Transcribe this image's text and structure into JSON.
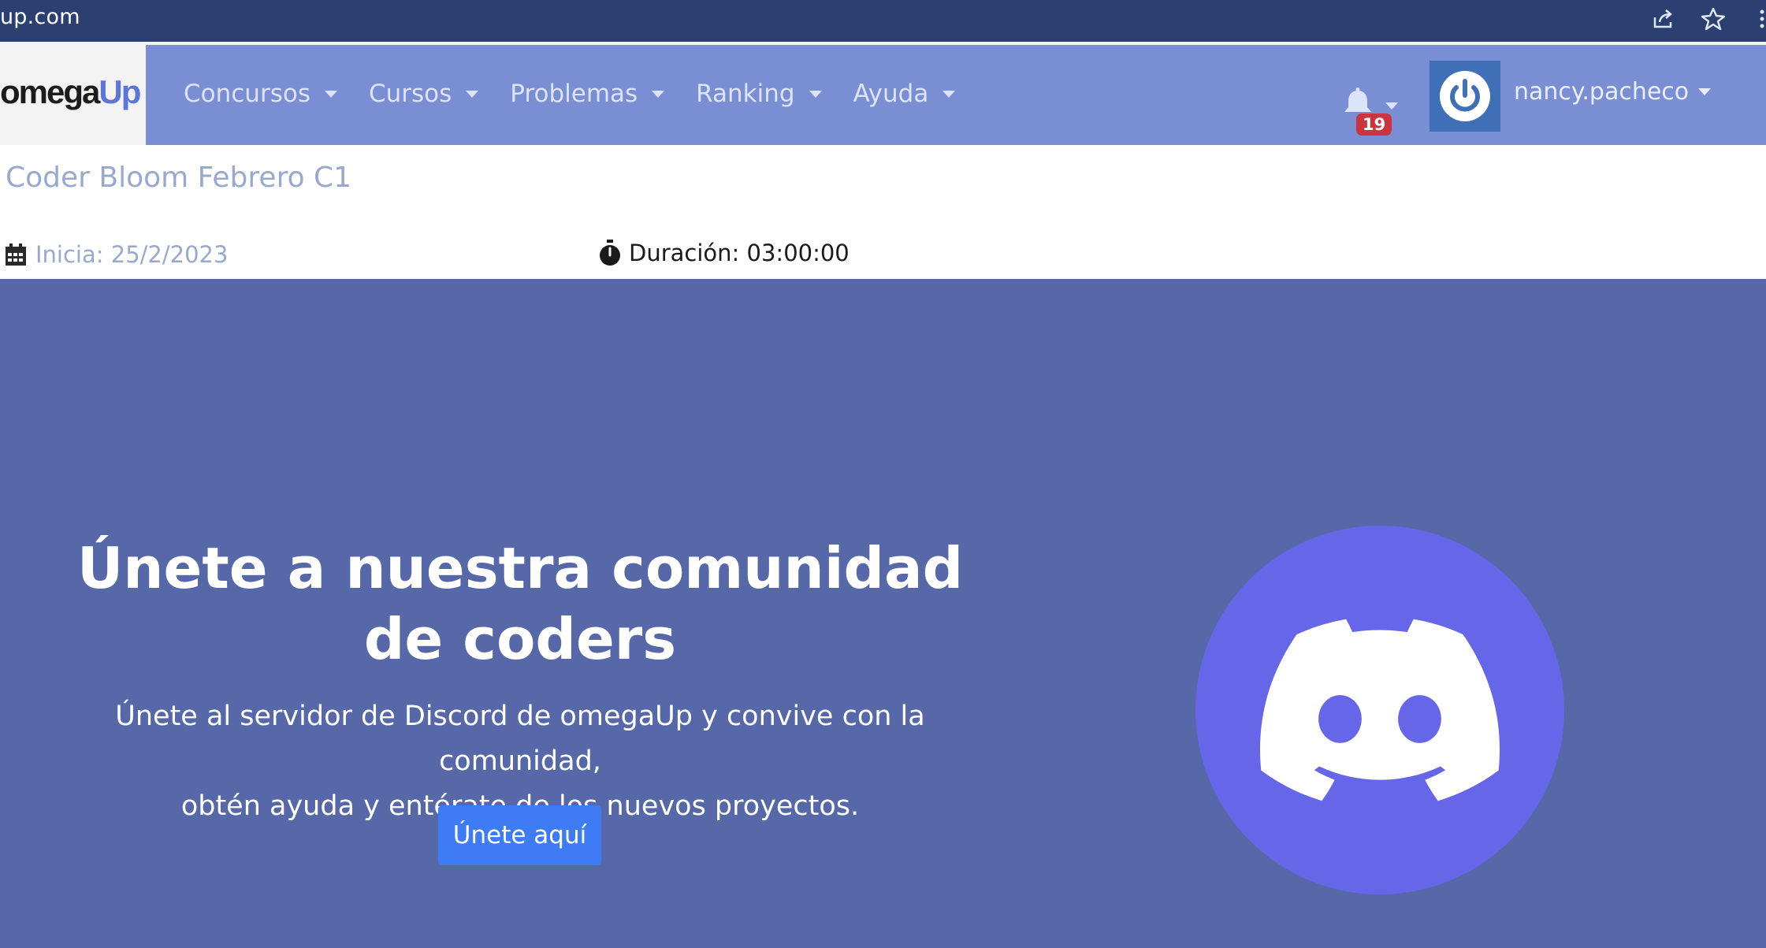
{
  "browser": {
    "url": "up.com"
  },
  "nav": {
    "logo_main": "omega",
    "logo_accent": "Up",
    "menu": [
      {
        "label": "Concursos"
      },
      {
        "label": "Cursos"
      },
      {
        "label": "Problemas"
      },
      {
        "label": "Ranking"
      },
      {
        "label": "Ayuda"
      }
    ],
    "notifications_count": "19",
    "username": "nancy.pacheco"
  },
  "contest": {
    "title": "Coder Bloom Febrero C1",
    "start": "Inicia: 25/2/2023",
    "duration": "Duración: 03:00:00"
  },
  "banner": {
    "title": "Únete a nuestra comunidad de coders",
    "subtitle_line1": "Únete al servidor de Discord de omegaUp y convive con la comunidad,",
    "subtitle_line2": "obtén ayuda y entérate de los nuevos proyectos.",
    "button": "Únete aquí"
  },
  "colors": {
    "navbar": "#7a8fd3",
    "banner": "#5768a9",
    "button": "#3d7cf5",
    "discord": "#6567e8",
    "badge": "#c9343f"
  },
  "icons": [
    "share-icon",
    "star-icon",
    "more-icon",
    "bell-icon",
    "power-icon",
    "calendar-icon",
    "stopwatch-icon",
    "discord-icon"
  ]
}
